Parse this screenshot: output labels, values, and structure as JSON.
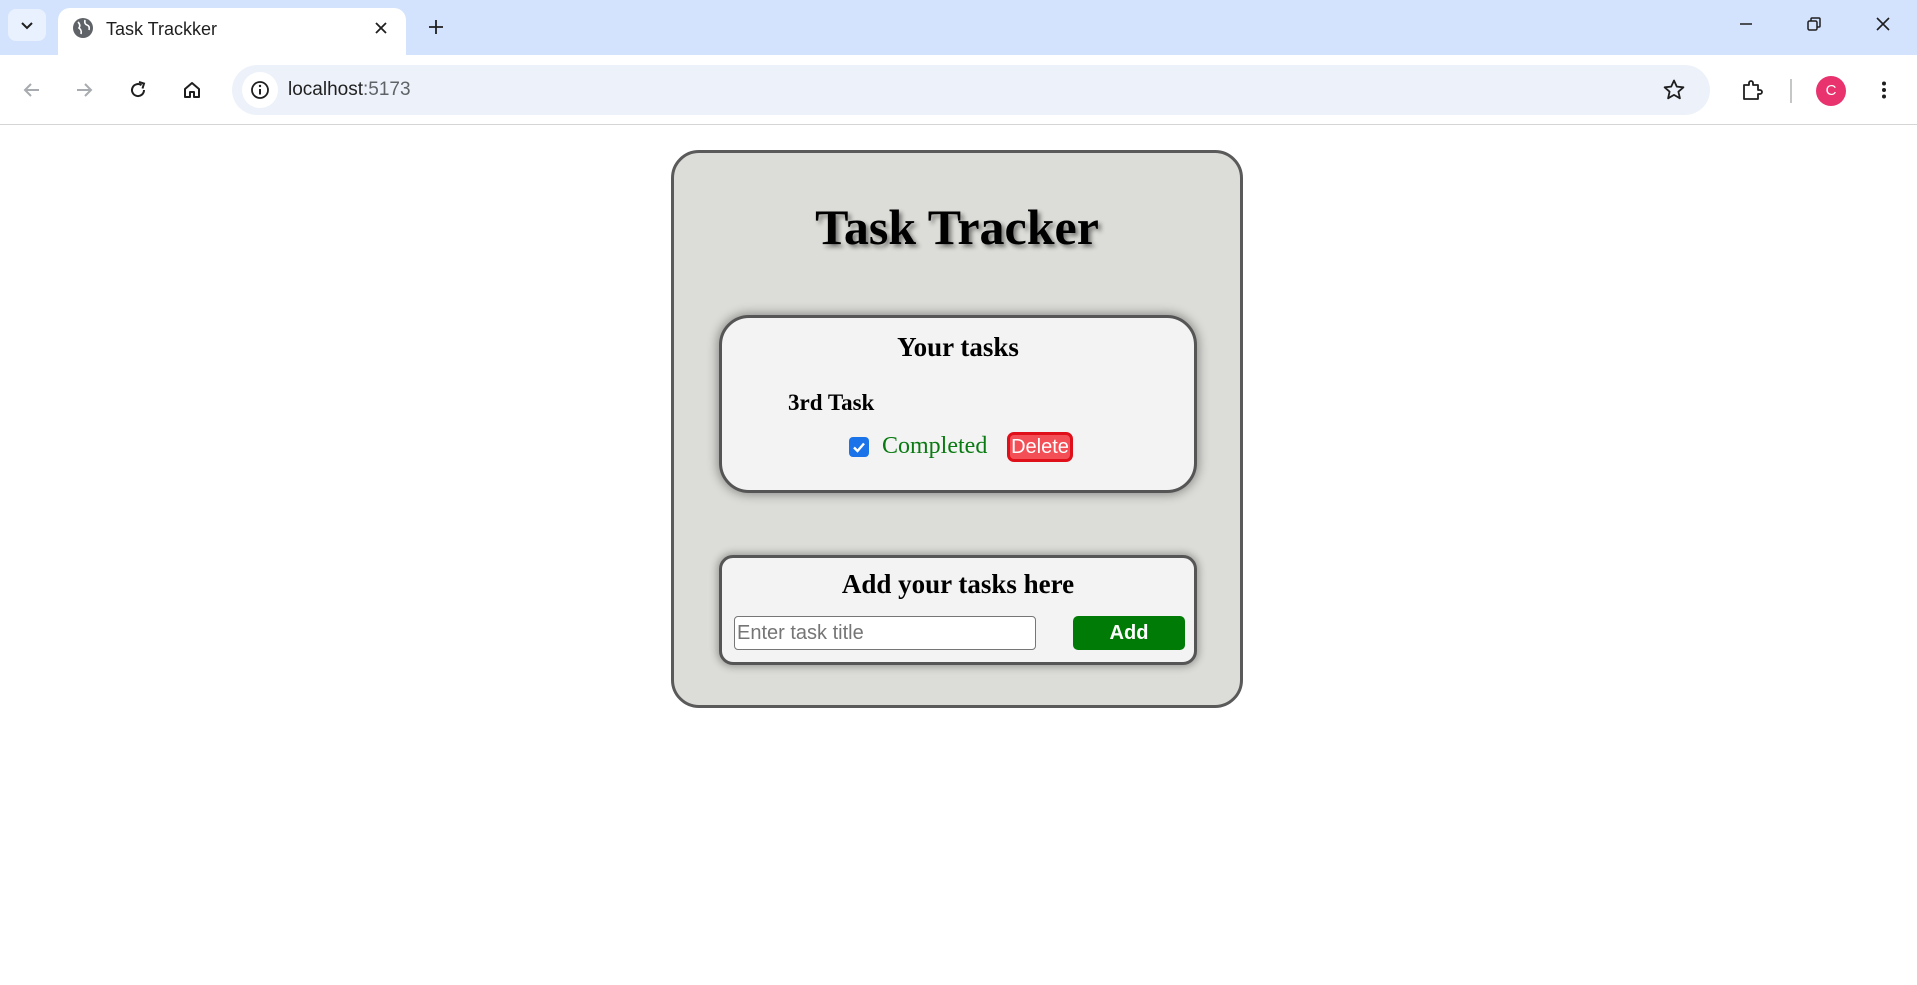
{
  "browser": {
    "tab_title": "Task Trackker",
    "url_host": "localhost",
    "url_port": ":5173",
    "profile_initial": "C",
    "accent_color": "#d3e3fd",
    "profile_color": "#e8336f"
  },
  "app": {
    "title": "Task Tracker",
    "tasks_heading": "Your tasks",
    "tasks": [
      {
        "name": "3rd Task",
        "completed": true,
        "status_label": "Completed",
        "delete_label": "Delete"
      }
    ],
    "add_heading": "Add your tasks here",
    "input_placeholder": "Enter task title",
    "input_value": "",
    "add_label": "Add",
    "colors": {
      "completed_text": "#0a7a12",
      "delete_button": "#f24f57",
      "add_button": "#007c06",
      "panel_background": "#dcdcd8"
    }
  }
}
